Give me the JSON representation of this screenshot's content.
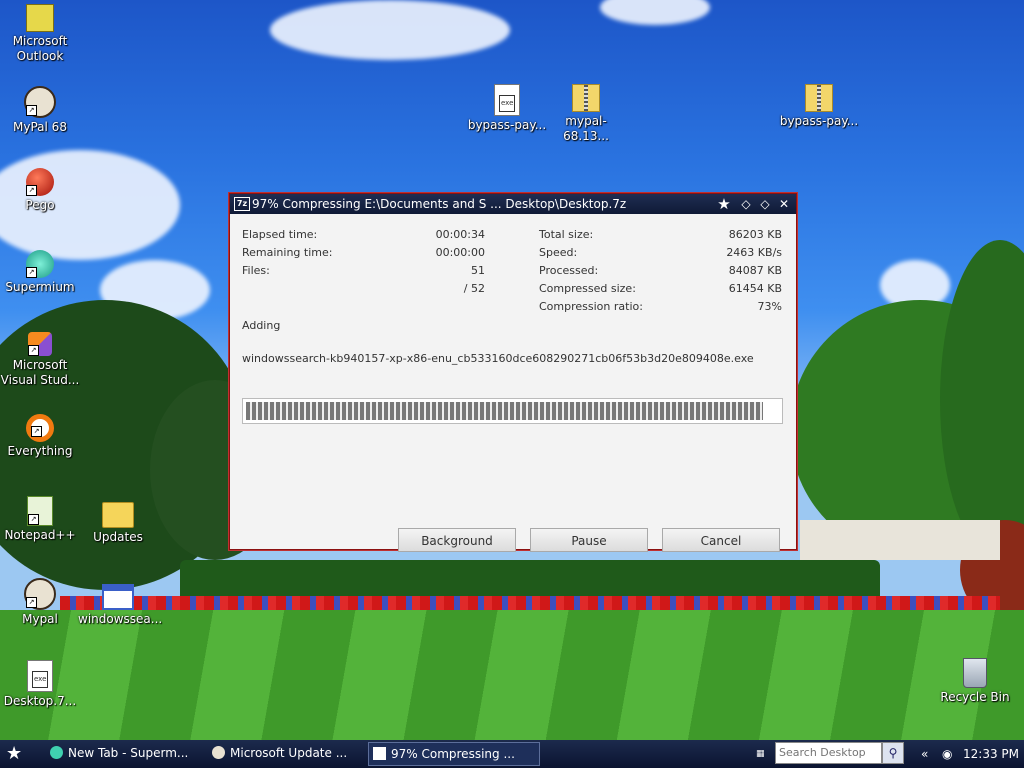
{
  "desktop": {
    "icons": [
      {
        "label": "Microsoft Outlook"
      },
      {
        "label": "MyPal 68"
      },
      {
        "label": "Pego"
      },
      {
        "label": "Supermium"
      },
      {
        "label": "Microsoft Visual Stud..."
      },
      {
        "label": "Everything"
      },
      {
        "label": "Notepad++"
      },
      {
        "label": "Updates"
      },
      {
        "label": "Mypal"
      },
      {
        "label": "windowssea..."
      },
      {
        "label": "Desktop.7..."
      },
      {
        "label": "bypass-pay..."
      },
      {
        "label": "mypal-68.13..."
      },
      {
        "label": "bypass-pay..."
      },
      {
        "label": "Recycle Bin"
      }
    ]
  },
  "dialog": {
    "app_icon": "7z",
    "title": "97% Compressing E:\\Documents and S ... Desktop\\Desktop.7z",
    "titlebar_icons": [
      "pin-star-icon",
      "minimize-icon",
      "maximize-icon",
      "close-icon"
    ],
    "left": {
      "elapsed_label": "Elapsed time:",
      "elapsed_value": "00:00:34",
      "remaining_label": "Remaining time:",
      "remaining_value": "00:00:00",
      "files_label": "Files:",
      "files_value": "51",
      "files_total": "/ 52"
    },
    "right": {
      "total_label": "Total size:",
      "total_value": "86203 KB",
      "speed_label": "Speed:",
      "speed_value": "2463 KB/s",
      "processed_label": "Processed:",
      "processed_value": "84087 KB",
      "compressed_label": "Compressed size:",
      "compressed_value": "61454 KB",
      "ratio_label": "Compression ratio:",
      "ratio_value": "73%"
    },
    "operation": "Adding",
    "current_file": "windowssearch-kb940157-xp-x86-enu_cb533160dce608290271cb06f53b3d20e809408e.exe",
    "progress": 0.97,
    "buttons": {
      "background": "Background",
      "pause": "Pause",
      "cancel": "Cancel"
    }
  },
  "taskbar": {
    "tasks": [
      {
        "label": "New Tab - Superm..."
      },
      {
        "label": "Microsoft Update ..."
      },
      {
        "label": "97% Compressing ..."
      }
    ],
    "search_placeholder": "Search Desktop",
    "clock": "12:33 PM",
    "tray_arrow": "«"
  }
}
